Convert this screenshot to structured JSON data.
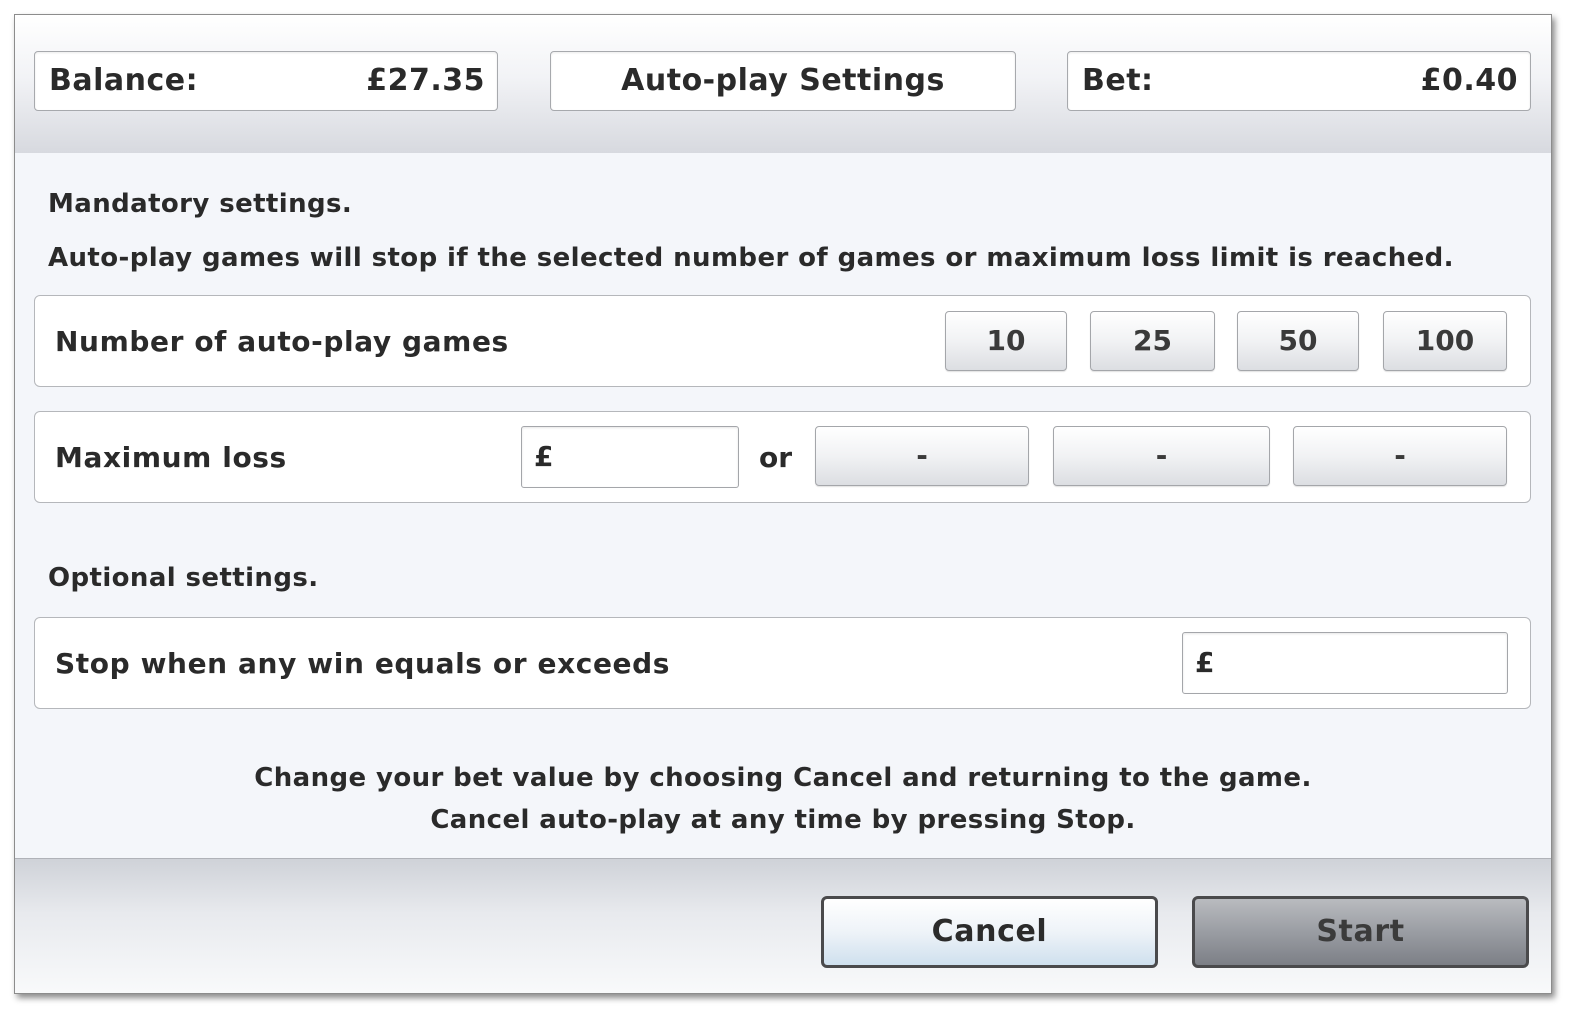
{
  "header": {
    "balance_label": "Balance:",
    "balance_value": "£27.35",
    "title": "Auto-play Settings",
    "bet_label": "Bet:",
    "bet_value": "£0.40"
  },
  "mandatory": {
    "title": "Mandatory settings.",
    "description": "Auto-play games will stop if the selected number of games or maximum loss limit is reached.",
    "games_label": "Number of auto-play games",
    "game_options": [
      "10",
      "25",
      "50",
      "100"
    ],
    "max_loss_label": "Maximum loss",
    "currency_symbol": "£",
    "or_label": "or",
    "loss_options": [
      "-",
      "-",
      "-"
    ]
  },
  "optional": {
    "title": "Optional settings.",
    "win_label": "Stop when any win equals or exceeds",
    "currency_symbol": "£"
  },
  "notes": {
    "line1": "Change your bet value by choosing Cancel and returning to the game.",
    "line2": "Cancel auto-play at any time by pressing Stop."
  },
  "buttons": {
    "cancel": "Cancel",
    "start": "Start"
  }
}
